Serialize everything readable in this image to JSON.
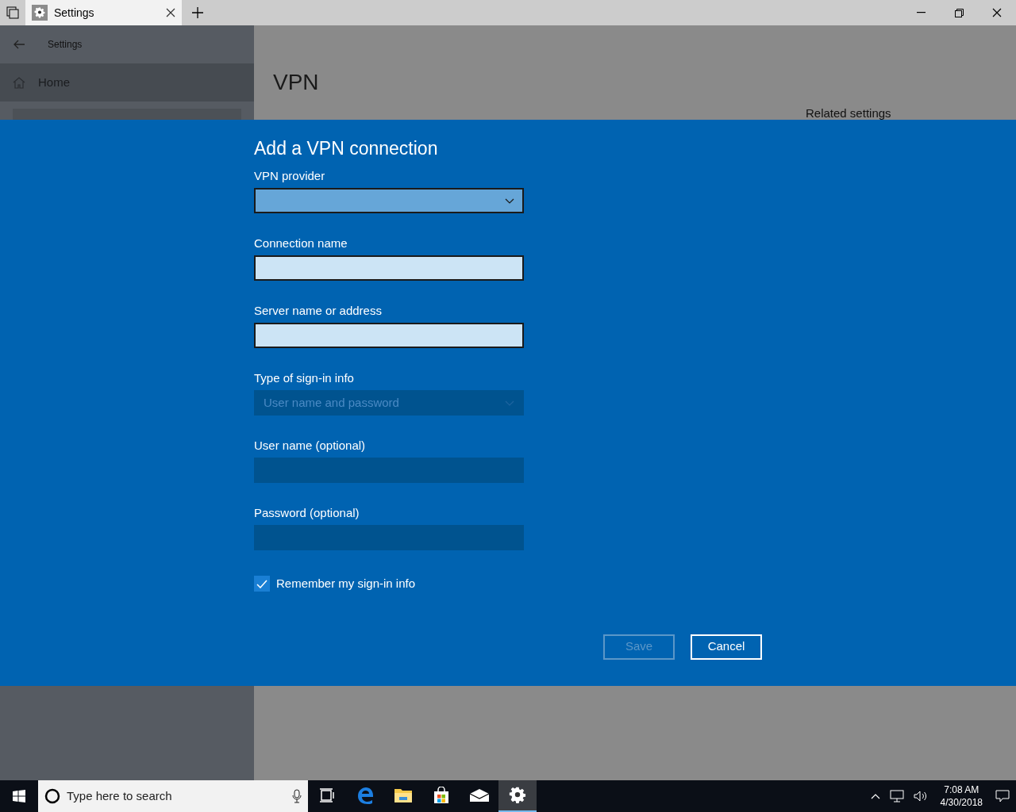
{
  "titlebar": {
    "tab": {
      "title": "Settings"
    }
  },
  "sidebar": {
    "title": "Settings",
    "home": "Home"
  },
  "content": {
    "title": "VPN",
    "related": "Related settings"
  },
  "dialog": {
    "title": "Add a VPN connection",
    "fields": [
      {
        "label": "VPN provider",
        "kind": "dropdown",
        "disabled": false
      },
      {
        "label": "Connection name",
        "kind": "text",
        "disabled": false
      },
      {
        "label": "Server name or address",
        "kind": "text",
        "disabled": false
      },
      {
        "label": "Type of sign-in info",
        "kind": "dropdown",
        "disabled": true,
        "value": "User name and password"
      },
      {
        "label": "User name (optional)",
        "kind": "text",
        "disabled": true
      },
      {
        "label": "Password (optional)",
        "kind": "text",
        "disabled": true
      }
    ],
    "remember": {
      "label": "Remember my sign-in info",
      "checked": true
    },
    "buttons": [
      {
        "label": "Save",
        "disabled": true
      },
      {
        "label": "Cancel",
        "disabled": false
      }
    ]
  },
  "taskbar": {
    "search_placeholder": "Type here to search",
    "apps": [
      {
        "kind": "taskview",
        "selected": false
      },
      {
        "kind": "edge",
        "selected": false
      },
      {
        "kind": "explorer",
        "selected": false
      },
      {
        "kind": "store",
        "selected": false
      },
      {
        "kind": "mail",
        "selected": false
      },
      {
        "kind": "settings",
        "selected": true
      }
    ],
    "time": "7:08 AM",
    "date": "4/30/2018"
  }
}
